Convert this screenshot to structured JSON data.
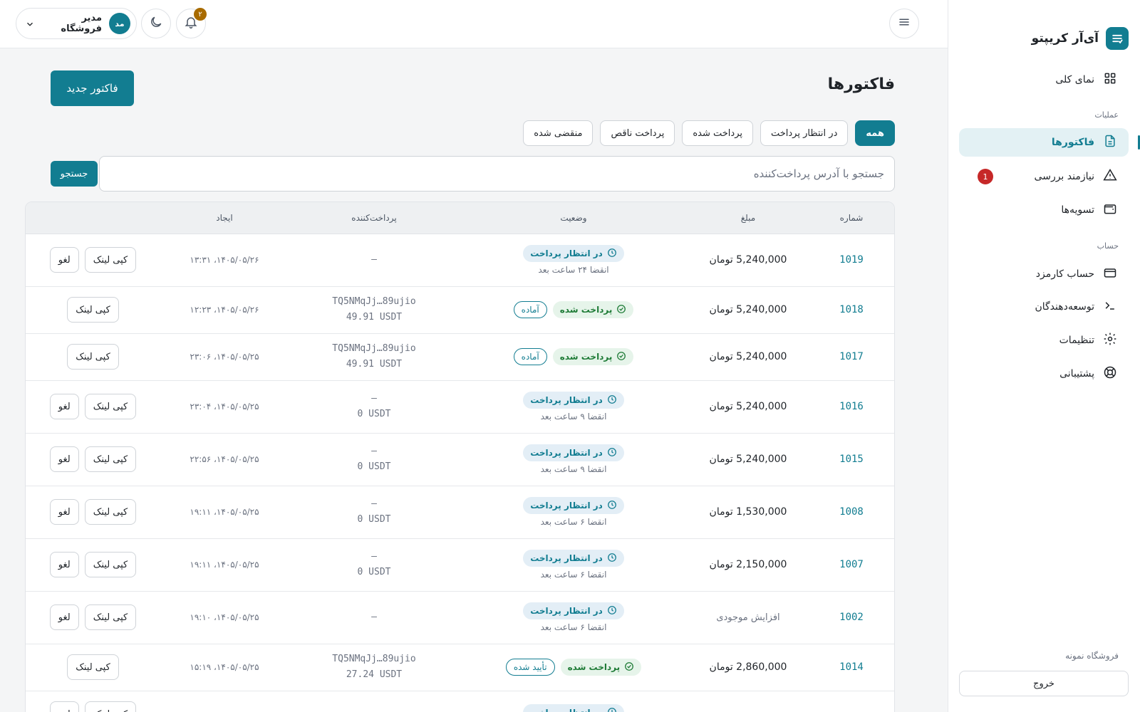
{
  "brand": {
    "name": "آی‌آر کریپتو"
  },
  "sidebar": {
    "items": [
      {
        "label": "نمای کلی",
        "icon": "grid-icon"
      },
      {
        "label": "فاکتورها",
        "icon": "document-icon",
        "active": true
      },
      {
        "label": "نیازمند بررسی",
        "icon": "warning-icon",
        "badge": "1"
      },
      {
        "label": "تسویه‌ها",
        "icon": "wallet-icon"
      },
      {
        "label": "حساب کارمزد",
        "icon": "card-icon"
      },
      {
        "label": "توسعه‌دهندگان",
        "icon": "terminal-icon"
      },
      {
        "label": "تنظیمات",
        "icon": "gear-icon"
      },
      {
        "label": "پشتیبانی",
        "icon": "lifebuoy-icon"
      }
    ],
    "section_operations": "عملیات",
    "section_account": "حساب",
    "store_label": "فروشگاه نمونه",
    "logout_label": "خروج"
  },
  "header": {
    "notification_count": "۲",
    "user": {
      "initials": "مد",
      "name": "مدیر فروشگاه"
    }
  },
  "page": {
    "title": "فاکتورها",
    "new_invoice_label": "فاکتور جدید",
    "filters": [
      "همه",
      "در انتظار پرداخت",
      "پرداخت شده",
      "پرداخت ناقص",
      "منقضی شده"
    ],
    "search_placeholder": "جستجو با آدرس پرداخت‌کننده",
    "search_button": "جستجو"
  },
  "table": {
    "columns": [
      "شماره",
      "مبلغ",
      "وضعیت",
      "پرداخت‌کننده",
      "ایجاد",
      ""
    ],
    "rows": [
      {
        "number": "1019",
        "amount": "5,240,000 تومان",
        "status": "در انتظار پرداخت",
        "status_type": "pending",
        "expiry": "انقضا ۲۴ ساعت بعد",
        "payer_line1": "—",
        "payer_line2": "",
        "created": "۱۴۰۵/۰۵/۲۶، ۱۳:۳۱",
        "actions": [
          "کپی لینک",
          "لغو"
        ]
      },
      {
        "number": "1018",
        "amount": "5,240,000 تومان",
        "status": "پرداخت شده",
        "status_type": "paid",
        "tag": "آماده",
        "payer_line1": "TQ5NMqJj…89ujio",
        "payer_line2": "49.91 USDT",
        "created": "۱۴۰۵/۰۵/۲۶، ۱۲:۲۳",
        "actions": [
          "کپی لینک"
        ]
      },
      {
        "number": "1017",
        "amount": "5,240,000 تومان",
        "status": "پرداخت شده",
        "status_type": "paid",
        "tag": "آماده",
        "payer_line1": "TQ5NMqJj…89ujio",
        "payer_line2": "49.91 USDT",
        "created": "۱۴۰۵/۰۵/۲۵، ۲۳:۰۶",
        "actions": [
          "کپی لینک"
        ]
      },
      {
        "number": "1016",
        "amount": "5,240,000 تومان",
        "status": "در انتظار پرداخت",
        "status_type": "pending",
        "expiry": "انقضا ۹ ساعت بعد",
        "payer_line1": "—",
        "payer_line2": "0 USDT",
        "created": "۱۴۰۵/۰۵/۲۵، ۲۳:۰۴",
        "actions": [
          "کپی لینک",
          "لغو"
        ]
      },
      {
        "number": "1015",
        "amount": "5,240,000 تومان",
        "status": "در انتظار پرداخت",
        "status_type": "pending",
        "expiry": "انقضا ۹ ساعت بعد",
        "payer_line1": "—",
        "payer_line2": "0 USDT",
        "created": "۱۴۰۵/۰۵/۲۵، ۲۲:۵۶",
        "actions": [
          "کپی لینک",
          "لغو"
        ]
      },
      {
        "number": "1008",
        "amount": "1,530,000 تومان",
        "status": "در انتظار پرداخت",
        "status_type": "pending",
        "expiry": "انقضا ۶ ساعت بعد",
        "payer_line1": "—",
        "payer_line2": "0 USDT",
        "created": "۱۴۰۵/۰۵/۲۵، ۱۹:۱۱",
        "actions": [
          "کپی لینک",
          "لغو"
        ]
      },
      {
        "number": "1007",
        "amount": "2,150,000 تومان",
        "status": "در انتظار پرداخت",
        "status_type": "pending",
        "expiry": "انقضا ۶ ساعت بعد",
        "payer_line1": "—",
        "payer_line2": "0 USDT",
        "created": "۱۴۰۵/۰۵/۲۵، ۱۹:۱۱",
        "actions": [
          "کپی لینک",
          "لغو"
        ]
      },
      {
        "number": "1002",
        "amount": "افزایش موجودی",
        "amount_muted": true,
        "status": "در انتظار پرداخت",
        "status_type": "pending",
        "expiry": "انقضا ۶ ساعت بعد",
        "payer_line1": "—",
        "payer_line2": "",
        "created": "۱۴۰۵/۰۵/۲۵، ۱۹:۱۰",
        "actions": [
          "کپی لینک",
          "لغو"
        ]
      },
      {
        "number": "1014",
        "amount": "2,860,000 تومان",
        "status": "پرداخت شده",
        "status_type": "paid",
        "tag": "تأیید شده",
        "payer_line1": "TQ5NMqJj…89ujio",
        "payer_line2": "27.24 USDT",
        "created": "۱۴۰۵/۰۵/۲۵، ۱۵:۱۹",
        "actions": [
          "کپی لینک"
        ]
      },
      {
        "number": "",
        "amount": "",
        "status": "در انتظار پرداخت",
        "status_type": "pending",
        "expiry": "",
        "payer_line1": "",
        "payer_line2": "",
        "created": "",
        "actions": [
          "کپی لینک",
          "لغو"
        ]
      }
    ]
  },
  "colors": {
    "accent": "#127d91",
    "paid": "#1e7b36",
    "danger": "#c62828",
    "notification": "#a86b00"
  }
}
